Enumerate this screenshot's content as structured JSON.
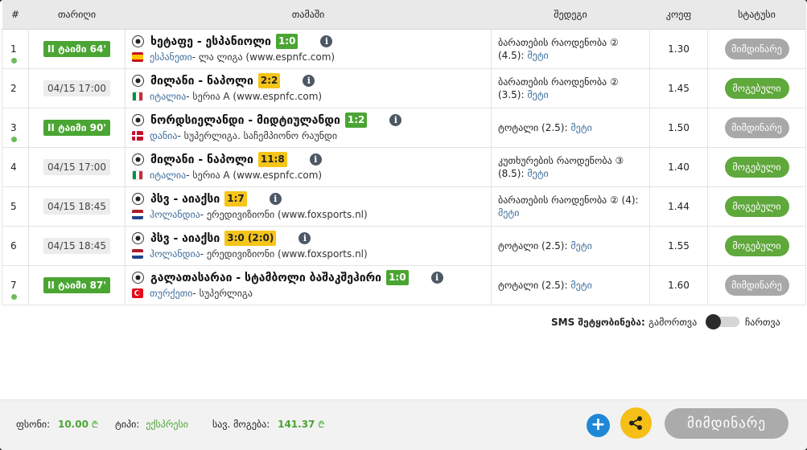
{
  "headers": {
    "num": "#",
    "date": "თარიღი",
    "game": "თამაში",
    "outcome": "შედეგი",
    "odds": "კოეფ",
    "status": "სტატუსი"
  },
  "rows": [
    {
      "num": "1",
      "date": "II ტაიმი 64'",
      "date_live": true,
      "teams": "ხეტაფე - ესპანიოლი",
      "score": "1:0",
      "score_color": "green",
      "country": "ესპანეთი",
      "league": " - ლა ლიგა (www.espnfc.com)",
      "flag": "es",
      "outcome": "ბარათების რაოდენობა ② (4.5):",
      "more": "მეტი",
      "odds": "1.30",
      "status": "მიმდინარე",
      "status_color": "gray"
    },
    {
      "num": "2",
      "date": "04/15 17:00",
      "date_live": false,
      "teams": "მილანი - ნაპოლი",
      "score": "2:2",
      "score_color": "yellow",
      "country": "იტალია",
      "league": " - სერია A (www.espnfc.com)",
      "flag": "it",
      "outcome": "ბარათების რაოდენობა ② (3.5):",
      "more": "მეტი",
      "odds": "1.45",
      "status": "მოგებული",
      "status_color": "green"
    },
    {
      "num": "3",
      "date": "II ტაიმი 90'",
      "date_live": true,
      "teams": "ნორდსიელანდი - მიდტიულანდი",
      "score": "1:2",
      "score_color": "green",
      "country": "დანია",
      "league": " - სუპერლიგა. საჩემპიონო რაუნდი",
      "flag": "dk",
      "outcome": "ტოტალი (2.5):",
      "more": "მეტი",
      "odds": "1.50",
      "status": "მიმდინარე",
      "status_color": "gray"
    },
    {
      "num": "4",
      "date": "04/15 17:00",
      "date_live": false,
      "teams": "მილანი - ნაპოლი",
      "score": "11:8",
      "score_color": "yellow",
      "country": "იტალია",
      "league": " - სერია A (www.espnfc.com)",
      "flag": "it",
      "outcome": "კუთხურების რაოდენობა ③ (8.5):",
      "more": "მეტი",
      "odds": "1.40",
      "status": "მოგებული",
      "status_color": "green"
    },
    {
      "num": "5",
      "date": "04/15 18:45",
      "date_live": false,
      "teams": "პსვ - აიაქსი",
      "score": "1:7",
      "score_color": "yellow",
      "country": "ჰოლანდია",
      "league": " - ერედივიზიონი (www.foxsports.nl)",
      "flag": "nl",
      "outcome": "ბარათების რაოდენობა ② (4):",
      "more": "მეტი",
      "odds": "1.44",
      "status": "მოგებული",
      "status_color": "green"
    },
    {
      "num": "6",
      "date": "04/15 18:45",
      "date_live": false,
      "teams": "პსვ - აიაქსი",
      "score": "3:0 (2:0)",
      "score_color": "yellow",
      "country": "ჰოლანდია",
      "league": " - ერედივიზიონი (www.foxsports.nl)",
      "flag": "nl",
      "outcome": "ტოტალი (2.5):",
      "more": "მეტი",
      "odds": "1.55",
      "status": "მოგებული",
      "status_color": "green"
    },
    {
      "num": "7",
      "date": "II ტაიმი 87'",
      "date_live": true,
      "teams": "გალათასარაი - სტამბოლი ბაშაკშეჰირი",
      "score": "1:0",
      "score_color": "green",
      "country": "თურქეთი",
      "league": " - სუპერლიგა",
      "flag": "tr",
      "outcome": "ტოტალი (2.5):",
      "more": "მეტი",
      "odds": "1.60",
      "status": "მიმდინარე",
      "status_color": "gray"
    }
  ],
  "sms": {
    "label": "SMS შეტყობინება:",
    "off": "გამორთვა",
    "on": "ჩართვა",
    "enabled": false
  },
  "footer": {
    "stake_label": "ფსონი:",
    "stake_value": "10.00",
    "currency": "₾",
    "type_label": "ტიპი:",
    "type_value": "ექსპრესი",
    "win_label": "სავ. მოგება:",
    "win_value": "141.37",
    "main_button": "მიმდინარე"
  },
  "icons": {
    "info": "info-icon",
    "ball": "soccer-ball-icon",
    "plus": "plus-icon",
    "share": "share-icon"
  },
  "colors": {
    "live_green": "#4aa533",
    "score_yellow": "#f6c519",
    "status_gray": "#a8a8a8",
    "status_green": "#5fa83c",
    "link_blue": "#3d6d9b",
    "plus_blue": "#1f87d6",
    "share_yellow": "#f5bf18"
  }
}
